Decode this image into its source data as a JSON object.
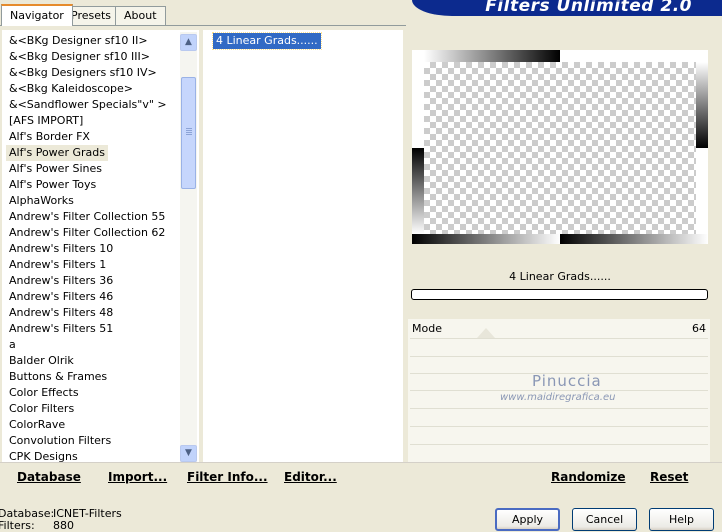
{
  "tabs": [
    "Navigator",
    "Presets",
    "About"
  ],
  "title": "Filters Unlimited 2.0",
  "categories": [
    "&<BKg Designer sf10 II>",
    "&<Bkg Designer sf10 III>",
    "&<Bkg Designers sf10 IV>",
    "&<Bkg Kaleidoscope>",
    "&<Sandflower Specials\"v\" >",
    "[AFS IMPORT]",
    "Alf's Border FX",
    "Alf's Power Grads",
    "Alf's Power Sines",
    "Alf's Power Toys",
    "AlphaWorks",
    "Andrew's Filter Collection 55",
    "Andrew's Filter Collection 62",
    "Andrew's Filters 10",
    "Andrew's Filters 1",
    "Andrew's Filters 36",
    "Andrew's Filters 46",
    "Andrew's Filters 48",
    "Andrew's Filters 51",
    "a",
    "Balder Olrik",
    "Buttons & Frames",
    "Color Effects",
    "Color Filters",
    "ColorRave",
    "Convolution Filters",
    "CPK Designs"
  ],
  "selected_category": "Alf's Power Grads",
  "filters": [
    "4 Linear Grads......"
  ],
  "selected_filter_label": "4 Linear Grads......",
  "progress": 0,
  "param": {
    "label": "Mode",
    "value": "64"
  },
  "watermark": {
    "line1": "Pinuccia",
    "line2": "www.maidiregrafica.eu"
  },
  "links": {
    "database": "Database",
    "import": "Import...",
    "filter_info": "Filter Info...",
    "editor": "Editor...",
    "randomize": "Randomize",
    "reset": "Reset"
  },
  "status": {
    "database_label": "Database:",
    "database_value": "ICNET-Filters",
    "filters_label": "Filters:",
    "filters_value": "880"
  },
  "buttons": {
    "apply": "Apply",
    "cancel": "Cancel",
    "help": "Help"
  },
  "colors": {
    "banner": "#0C2A8E",
    "selection": "#316AC5",
    "tab_highlight": "#E68B2C"
  }
}
